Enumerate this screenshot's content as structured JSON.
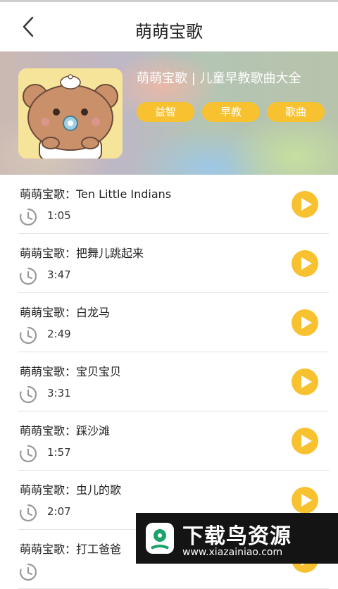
{
  "header": {
    "title": "萌萌宝歌",
    "back_icon": "chevron-left-icon"
  },
  "banner": {
    "playlist_title": "萌萌宝歌 | 儿童早教歌曲大全",
    "tags": [
      "益智",
      "早教",
      "歌曲"
    ],
    "accent": "#f7c12f"
  },
  "songs": [
    {
      "title": "萌萌宝歌：Ten Little Indians",
      "duration": "1:05"
    },
    {
      "title": "萌萌宝歌：把舞儿跳起来",
      "duration": "3:47"
    },
    {
      "title": "萌萌宝歌：白龙马",
      "duration": "2:49"
    },
    {
      "title": "萌萌宝歌：宝贝宝贝",
      "duration": "3:31"
    },
    {
      "title": "萌萌宝歌：踩沙滩",
      "duration": "1:57"
    },
    {
      "title": "萌萌宝歌：虫儿的歌",
      "duration": "2:07"
    },
    {
      "title": "萌萌宝歌：打工爸爸",
      "duration": ""
    }
  ],
  "watermark": {
    "text": "下载鸟资源",
    "url": "www.xiazainiao.com"
  }
}
